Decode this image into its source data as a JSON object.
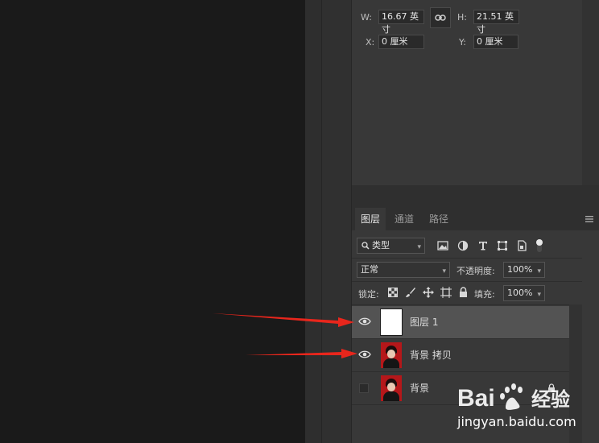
{
  "properties": {
    "w_label": "W:",
    "w_value": "16.67 英寸",
    "h_label": "H:",
    "h_value": "21.51 英寸",
    "x_label": "X:",
    "x_value": "0 厘米",
    "y_label": "Y:",
    "y_value": "0 厘米"
  },
  "layers_panel": {
    "tabs": [
      {
        "label": "图层",
        "active": true
      },
      {
        "label": "通道",
        "active": false
      },
      {
        "label": "路径",
        "active": false
      }
    ],
    "filter_kind": "类型",
    "blend_mode": "正常",
    "opacity_label": "不透明度:",
    "opacity_value": "100%",
    "lock_label": "锁定:",
    "fill_label": "填充:",
    "fill_value": "100%",
    "layers": [
      {
        "name": "图层 1",
        "visible": true,
        "selected": true,
        "thumbnail": "white-fill"
      },
      {
        "name": "背景 拷贝",
        "visible": true,
        "selected": false,
        "thumbnail": "portrait"
      },
      {
        "name": "背景",
        "visible": false,
        "selected": false,
        "thumbnail": "portrait",
        "locked": true
      }
    ]
  },
  "annotations": {
    "arrow_color": "#e8261c"
  },
  "watermark": {
    "logo": "Bai 经验",
    "url": "jingyan.baidu.com"
  }
}
